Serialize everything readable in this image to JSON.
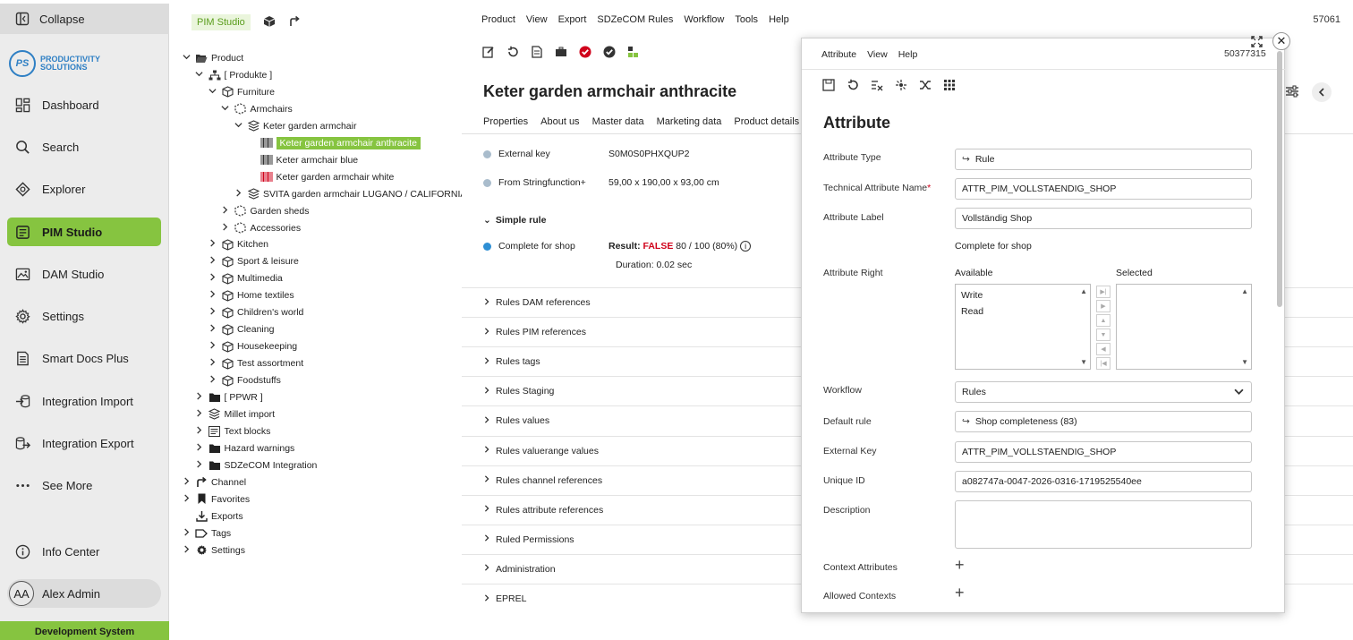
{
  "sidebar": {
    "collapse_label": "Collapse",
    "logo": {
      "initials": "PS",
      "line1": "PRODUCTIVITY",
      "line2": "SOLUTIONS"
    },
    "items": [
      {
        "label": "Dashboard",
        "icon": "dashboard-icon"
      },
      {
        "label": "Search",
        "icon": "search-icon"
      },
      {
        "label": "Explorer",
        "icon": "explorer-icon"
      },
      {
        "label": "PIM Studio",
        "icon": "pim-studio-icon",
        "active": true
      },
      {
        "label": "DAM Studio",
        "icon": "image-icon"
      },
      {
        "label": "Settings",
        "icon": "gear-icon"
      },
      {
        "label": "Smart Docs Plus",
        "icon": "document-icon"
      },
      {
        "label": "Integration Import",
        "icon": "import-icon"
      },
      {
        "label": "Integration Export",
        "icon": "export-icon"
      },
      {
        "label": "See More",
        "icon": "more-icon"
      }
    ],
    "info_center": "Info Center",
    "user": {
      "initials": "AA",
      "name": "Alex Admin"
    },
    "environment": "Development System"
  },
  "tree": {
    "tab_label": "PIM Studio",
    "rows": [
      {
        "label": "Product",
        "indent": 0,
        "chev": "down",
        "icon": "folder-open"
      },
      {
        "label": "[ Produkte ]",
        "indent": 1,
        "chev": "down",
        "icon": "hierarchy"
      },
      {
        "label": "Furniture",
        "indent": 2,
        "chev": "down",
        "icon": "box"
      },
      {
        "label": "Armchairs",
        "indent": 3,
        "chev": "down",
        "icon": "dashed-box"
      },
      {
        "label": "Keter garden armchair",
        "indent": 4,
        "chev": "down",
        "icon": "layers"
      },
      {
        "label": "Keter garden armchair anthracite",
        "indent": 5,
        "chev": "",
        "icon": "barcode",
        "selected": true
      },
      {
        "label": "Keter armchair blue",
        "indent": 5,
        "chev": "",
        "icon": "barcode"
      },
      {
        "label": "Keter garden armchair white",
        "indent": 5,
        "chev": "",
        "icon": "barcode-red"
      },
      {
        "label": "SVITA garden armchair LUGANO / CALIFORNIA",
        "indent": 4,
        "chev": "right",
        "icon": "layers"
      },
      {
        "label": "Garden sheds",
        "indent": 3,
        "chev": "right",
        "icon": "dashed-box"
      },
      {
        "label": "Accessories",
        "indent": 3,
        "chev": "right",
        "icon": "dashed-box"
      },
      {
        "label": "Kitchen",
        "indent": 2,
        "chev": "right",
        "icon": "box"
      },
      {
        "label": "Sport & leisure",
        "indent": 2,
        "chev": "right",
        "icon": "box"
      },
      {
        "label": "Multimedia",
        "indent": 2,
        "chev": "right",
        "icon": "box"
      },
      {
        "label": "Home textiles",
        "indent": 2,
        "chev": "right",
        "icon": "box"
      },
      {
        "label": "Children's world",
        "indent": 2,
        "chev": "right",
        "icon": "box"
      },
      {
        "label": "Cleaning",
        "indent": 2,
        "chev": "right",
        "icon": "box"
      },
      {
        "label": "Housekeeping",
        "indent": 2,
        "chev": "right",
        "icon": "box"
      },
      {
        "label": "Test assortment",
        "indent": 2,
        "chev": "right",
        "icon": "box"
      },
      {
        "label": "Foodstuffs",
        "indent": 2,
        "chev": "right",
        "icon": "box"
      },
      {
        "label": "[ PPWR ]",
        "indent": 1,
        "chev": "right",
        "icon": "folder"
      },
      {
        "label": "Millet import",
        "indent": 1,
        "chev": "right",
        "icon": "layers"
      },
      {
        "label": "Text blocks",
        "indent": 1,
        "chev": "right",
        "icon": "textblock"
      },
      {
        "label": "Hazard warnings",
        "indent": 1,
        "chev": "right",
        "icon": "folder"
      },
      {
        "label": "SDZeCOM Integration",
        "indent": 1,
        "chev": "right",
        "icon": "folder"
      },
      {
        "label": "Channel",
        "indent": 0,
        "chev": "right",
        "icon": "channel"
      },
      {
        "label": "Favorites",
        "indent": 0,
        "chev": "right",
        "icon": "bookmark"
      },
      {
        "label": "Exports",
        "indent": 0,
        "chev": "",
        "icon": "download"
      },
      {
        "label": "Tags",
        "indent": 0,
        "chev": "right",
        "icon": "tag"
      },
      {
        "label": "Settings",
        "indent": 0,
        "chev": "right",
        "icon": "gear"
      }
    ]
  },
  "main": {
    "menu": [
      "Product",
      "View",
      "Export",
      "SDZeCOM Rules",
      "Workflow",
      "Tools",
      "Help"
    ],
    "id": "57061",
    "title": "Keter garden armchair anthracite",
    "tabs": [
      "Properties",
      "About us",
      "Master data",
      "Marketing data",
      "Product details"
    ],
    "fields": [
      {
        "key": "External key",
        "value": "S0M0S0PHXQUP2"
      },
      {
        "key": "From Stringfunction+",
        "value": "59,00 x 190,00 x 93,00 cm"
      }
    ],
    "simple_rule": {
      "heading": "Simple rule",
      "key": "Complete for shop",
      "result_label": "Result:",
      "result_value": "FALSE",
      "result_detail": "80 / 100 (80%)",
      "duration": "Duration: 0.02 sec"
    },
    "sections": [
      "Rules DAM references",
      "Rules PIM references",
      "Rules tags",
      "Rules Staging",
      "Rules values",
      "Rules valuerange values",
      "Rules channel references",
      "Rules attribute references",
      "Ruled Permissions",
      "Administration",
      "EPREL"
    ]
  },
  "dialog": {
    "menu": [
      "Attribute",
      "View",
      "Help"
    ],
    "id": "50377315",
    "title": "Attribute",
    "attribute_type_label": "Attribute Type",
    "attribute_type_value": "Rule",
    "tech_name_label": "Technical Attribute Name",
    "tech_name_value": "ATTR_PIM_VOLLSTAENDIG_SHOP",
    "attr_label_label": "Attribute Label",
    "attr_label_value": "Vollständig Shop",
    "attr_label_translation": "Complete for shop",
    "attr_right_label": "Attribute Right",
    "available_label": "Available",
    "selected_label": "Selected",
    "available_options": [
      "Write",
      "Read"
    ],
    "workflow_label": "Workflow",
    "workflow_value": "Rules",
    "default_rule_label": "Default rule",
    "default_rule_value": "Shop completeness (83)",
    "external_key_label": "External Key",
    "external_key_value": "ATTR_PIM_VOLLSTAENDIG_SHOP",
    "unique_id_label": "Unique ID",
    "unique_id_value": "a082747a-0047-2026-0316-1719525540ee",
    "description_label": "Description",
    "context_attributes_label": "Context Attributes",
    "allowed_contexts_label": "Allowed Contexts"
  },
  "colors": {
    "accent": "#86c440",
    "error": "#d0021b",
    "link": "#2e7fc4"
  }
}
